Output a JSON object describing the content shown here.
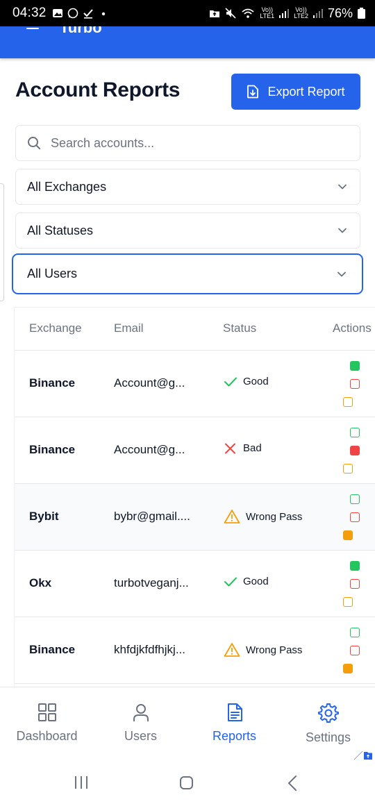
{
  "status_bar": {
    "time": "04:32",
    "net1": "Vo))",
    "net1b": "LTE1",
    "net2": "Vo))",
    "net2b": "LTE2",
    "battery": "76%"
  },
  "app_bar": {
    "brand": "Turbo"
  },
  "header": {
    "title": "Account Reports",
    "export_label": "Export Report"
  },
  "filters": {
    "search_placeholder": "Search accounts...",
    "exchange": "All Exchanges",
    "status": "All Statuses",
    "user": "All Users"
  },
  "table": {
    "columns": [
      "Exchange",
      "Email",
      "Status",
      "Actions"
    ],
    "rows": [
      {
        "exchange": "Binance",
        "email": "Account@g...",
        "status": "Good",
        "status_type": "good",
        "action_checked": "good"
      },
      {
        "exchange": "Binance",
        "email": "Account@g...",
        "status": "Bad",
        "status_type": "bad",
        "action_checked": "bad"
      },
      {
        "exchange": "Bybit",
        "email": "bybr@gmail....",
        "status": "Wrong Pass",
        "status_type": "warn",
        "action_checked": "warn"
      },
      {
        "exchange": "Okx",
        "email": "turbotveganj...",
        "status": "Good",
        "status_type": "good",
        "action_checked": "good"
      },
      {
        "exchange": "Binance",
        "email": "khfdjkfdfhjkj...",
        "status": "Wrong Pass",
        "status_type": "warn",
        "action_checked": "warn"
      }
    ]
  },
  "bottom_nav": {
    "items": [
      {
        "label": "Dashboard",
        "icon": "grid-icon"
      },
      {
        "label": "Users",
        "icon": "user-icon"
      },
      {
        "label": "Reports",
        "icon": "document-icon",
        "active": true
      },
      {
        "label": "Settings",
        "icon": "gear-icon"
      }
    ]
  },
  "colors": {
    "primary": "#2563eb",
    "good": "#22c55e",
    "bad": "#ef4444",
    "warn": "#f59e0b"
  }
}
